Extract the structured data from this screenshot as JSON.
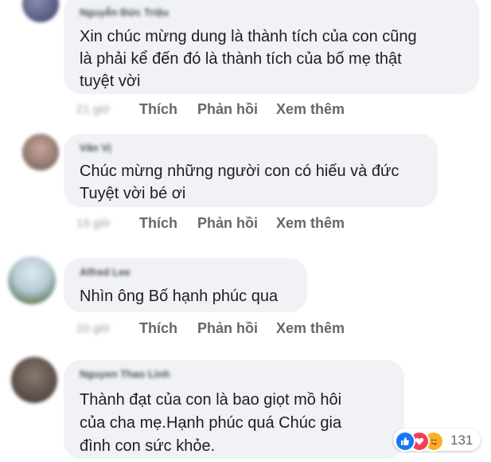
{
  "comments": [
    {
      "author": "Nguyễn Đức Triệu",
      "lines": [
        "Xin chúc mừng dung là thành tích của con cũng",
        "là phải kể đến đó là thành tích của bố mẹ thật",
        "tuyệt vời"
      ],
      "time": "21 giờ",
      "like": "Thích",
      "reply": "Phản hồi",
      "more": "Xem thêm"
    },
    {
      "author": "Văn Vị",
      "lines": [
        "Chúc mừng những người con có hiếu và đức",
        "Tuyệt vời bé ơi"
      ],
      "time": "19 giờ",
      "like": "Thích",
      "reply": "Phản hồi",
      "more": "Xem thêm"
    },
    {
      "author": "Alfred Lee",
      "lines": [
        "Nhìn ông Bố hạnh phúc qua"
      ],
      "time": "20 giờ",
      "like": "Thích",
      "reply": "Phản hồi",
      "more": "Xem thêm"
    },
    {
      "author": "Nguyen Thao Linh",
      "lines": [
        "Thành đạt của con là bao giọt mồ hôi",
        "của cha mẹ.Hạnh phúc quá Chúc gia",
        "đình con sức khỏe."
      ],
      "time": "",
      "like": "",
      "reply": "",
      "more": ""
    }
  ],
  "reactions": {
    "icons": [
      "like-icon",
      "love-icon",
      "care-icon"
    ],
    "count": "131",
    "colors": {
      "like": "#1877f2",
      "love": "#f33e58",
      "care": "#f7b125"
    }
  }
}
